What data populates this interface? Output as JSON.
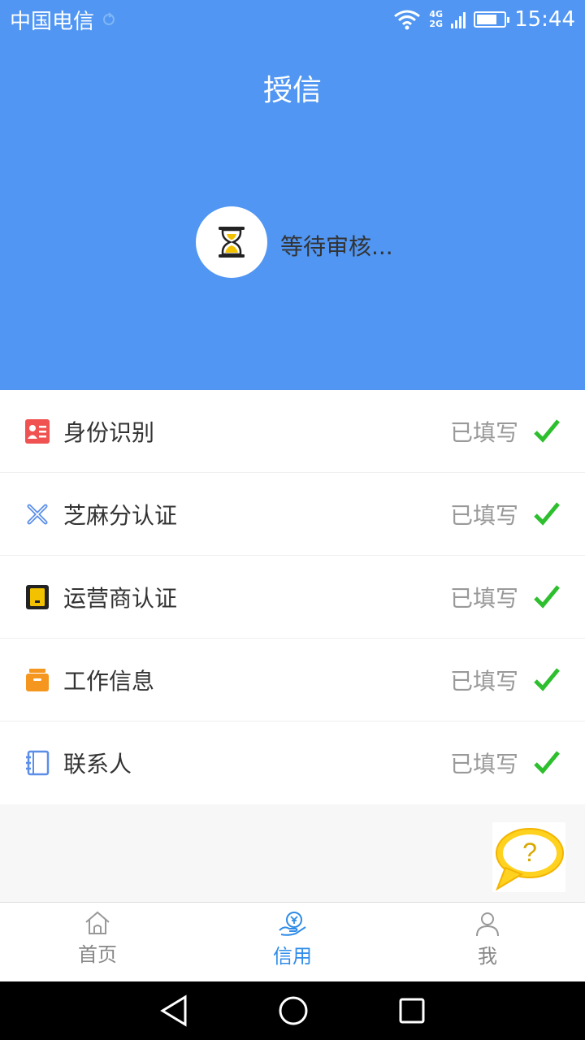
{
  "status_bar": {
    "carrier": "中国电信",
    "network_top": "4G",
    "network_bottom": "2G",
    "time": "15:44"
  },
  "header": {
    "title": "授信",
    "status_text": "等待审核..."
  },
  "items": [
    {
      "label": "身份识别",
      "state": "已填写"
    },
    {
      "label": "芝麻分认证",
      "state": "已填写"
    },
    {
      "label": "运营商认证",
      "state": "已填写"
    },
    {
      "label": "工作信息",
      "state": "已填写"
    },
    {
      "label": "联系人",
      "state": "已填写"
    }
  ],
  "help": {
    "glyph": "?"
  },
  "tabs": [
    {
      "label": "首页",
      "icon": "home-icon"
    },
    {
      "label": "信用",
      "icon": "credit-icon"
    },
    {
      "label": "我",
      "icon": "person-icon"
    }
  ],
  "colors": {
    "primary": "#5096f2",
    "tab_active": "#2f8ce8",
    "check": "#2dbf2d"
  }
}
